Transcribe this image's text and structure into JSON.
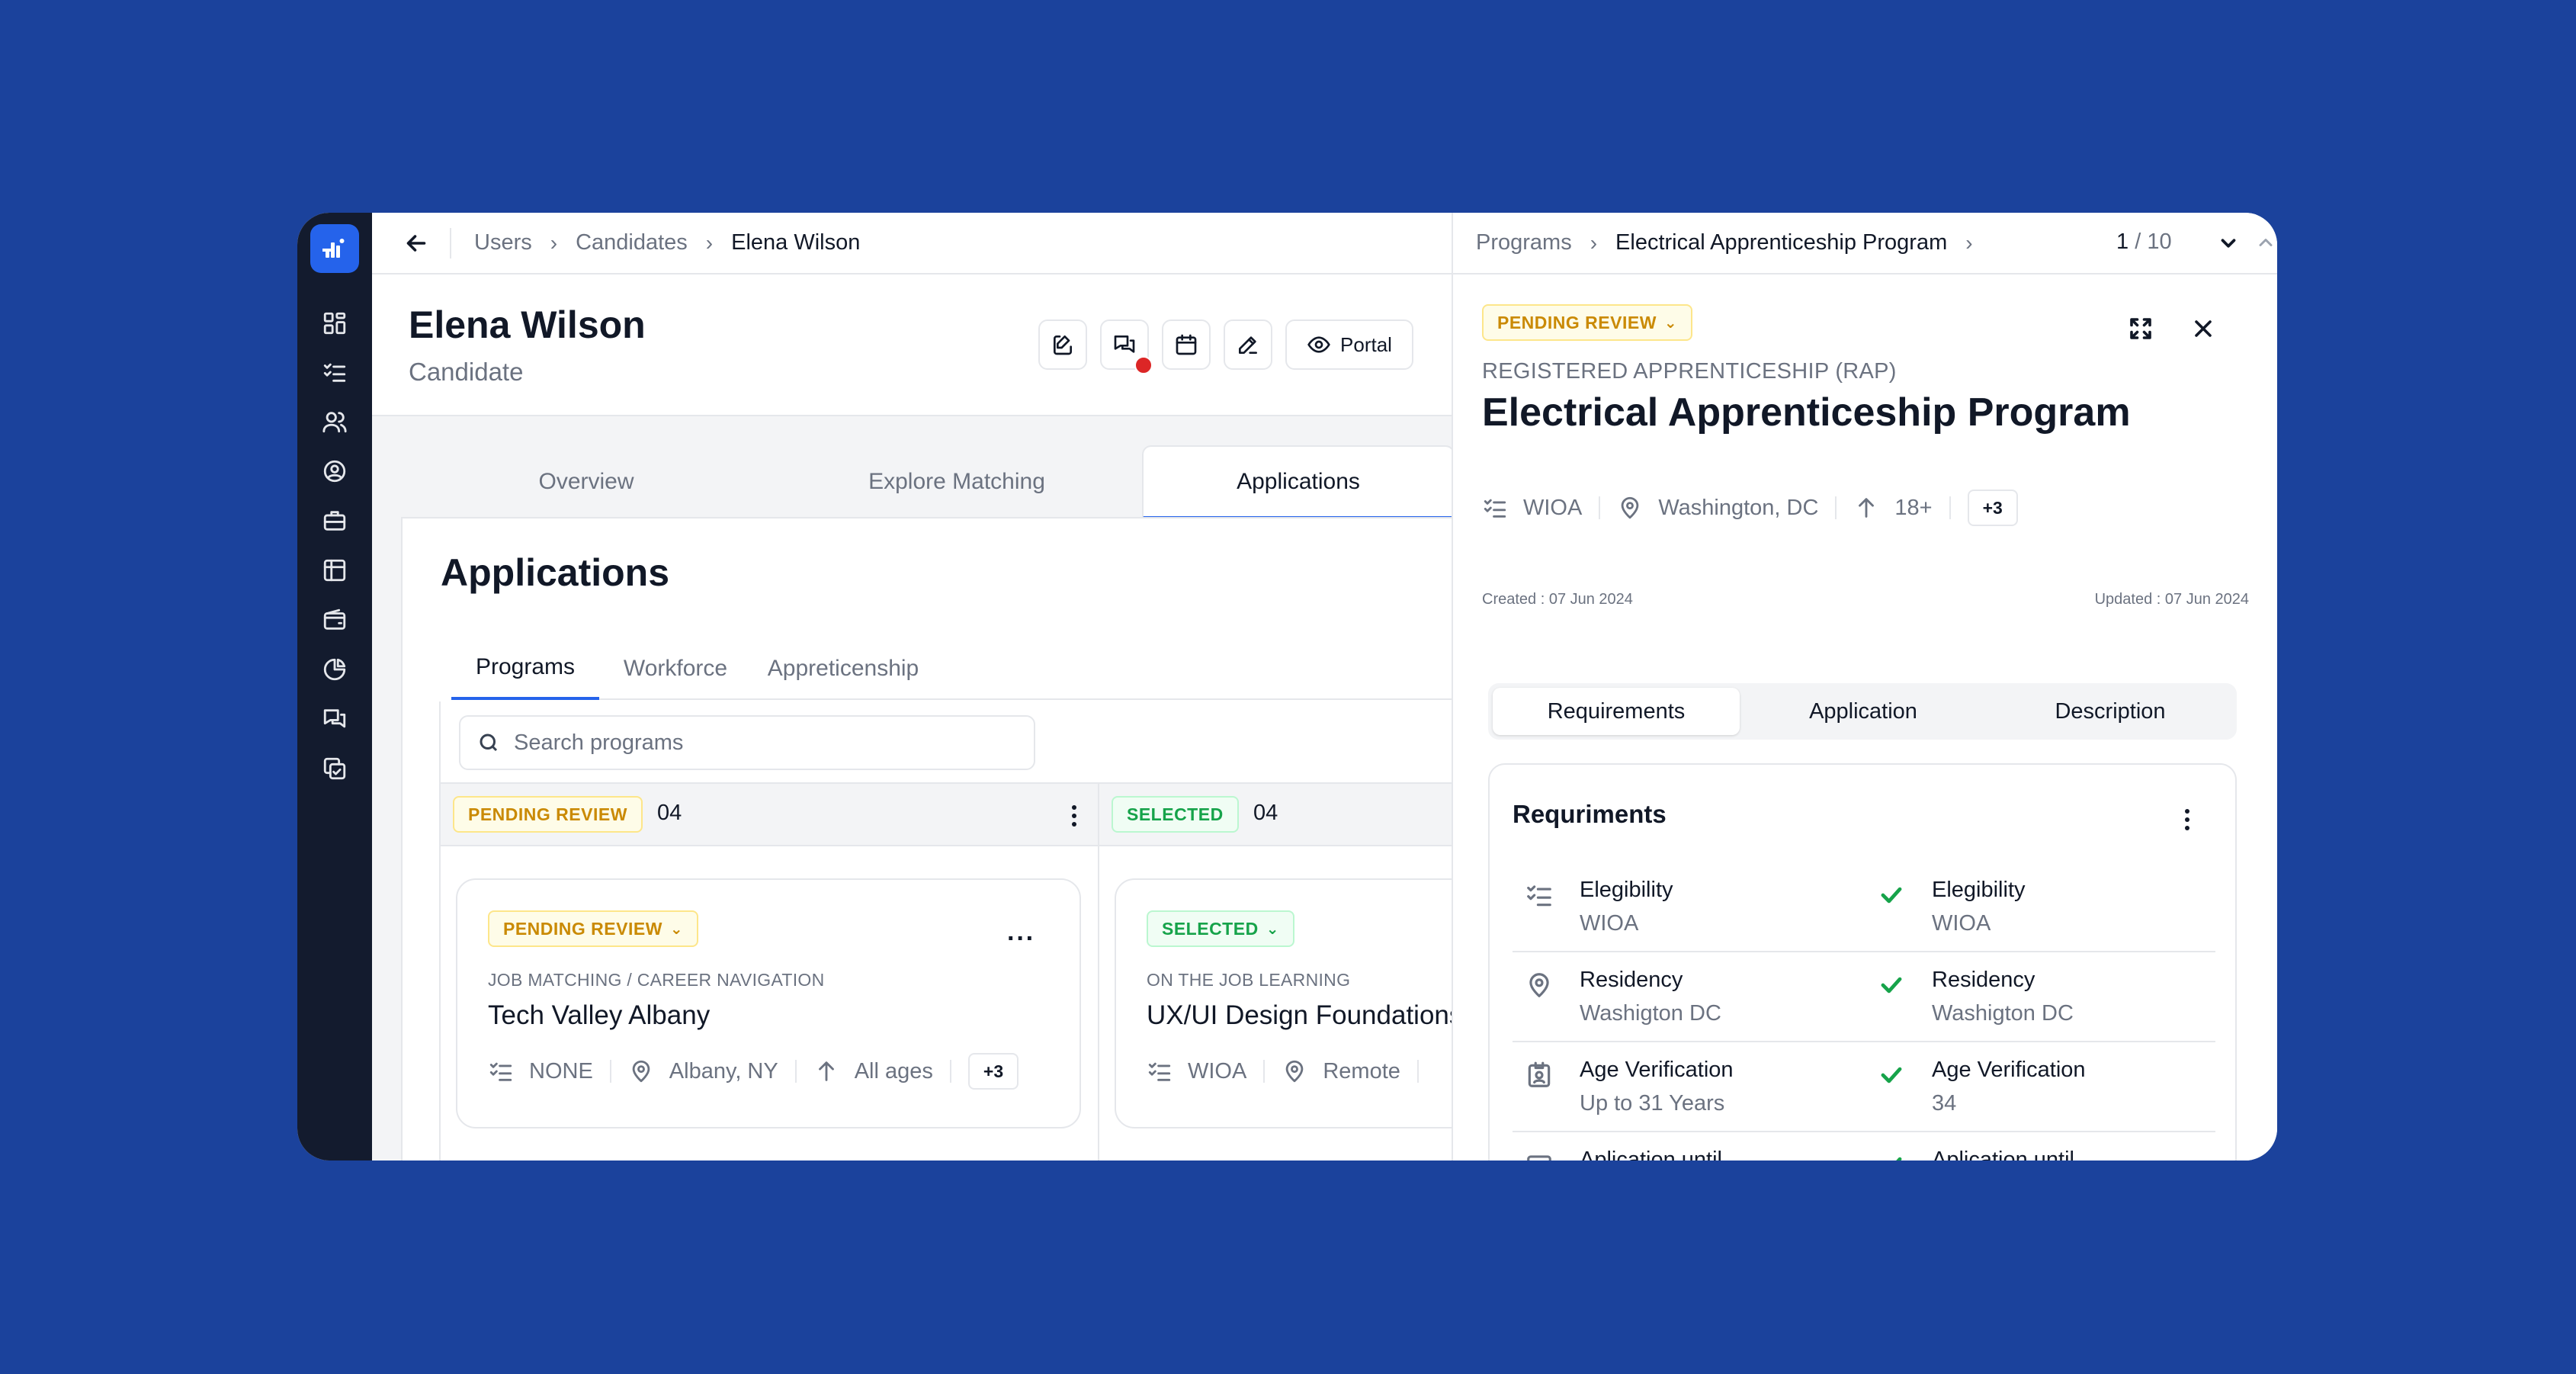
{
  "breadcrumb": {
    "items": [
      "Users",
      "Candidates",
      "Elena Wilson"
    ]
  },
  "candidate": {
    "name": "Elena Wilson",
    "role": "Candidate"
  },
  "header_actions": {
    "portal_label": "Portal",
    "icons": [
      "clipboard-edit-icon",
      "chat-icon",
      "calendar-icon",
      "pencil-icon",
      "eye-icon"
    ]
  },
  "main_tabs": [
    "Overview",
    "Explore Matching",
    "Applications"
  ],
  "applications": {
    "title": "Applications",
    "subtabs": [
      "Programs",
      "Workforce",
      "Appreticenship"
    ],
    "search_placeholder": "Search programs",
    "columns": [
      {
        "status": "PENDING REVIEW",
        "count": "04"
      },
      {
        "status": "SELECTED",
        "count": "04"
      }
    ],
    "cards": [
      {
        "status": "PENDING REVIEW",
        "type": "JOB MATCHING / CAREER NAVIGATION",
        "name": "Tech Valley Albany",
        "eligibility": "NONE",
        "location": "Albany, NY",
        "age": "All ages",
        "more": "+3"
      },
      {
        "status": "SELECTED",
        "type": "ON THE JOB LEARNING",
        "name": "UX/UI Design Foundations",
        "eligibility": "WIOA",
        "location": "Remote"
      }
    ]
  },
  "detail": {
    "breadcrumb": [
      "Programs",
      "Electrical Apprenticeship Program"
    ],
    "pager": {
      "current": "1",
      "total": "/ 10"
    },
    "status": "PENDING REVIEW",
    "category": "REGISTERED APPRENTICESHIP (RAP)",
    "title": "Electrical Apprenticeship Program",
    "meta": {
      "eligibility": "WIOA",
      "location": "Washington, DC",
      "age": "18+",
      "more": "+3"
    },
    "created": "Created : 07 Jun 2024",
    "updated": "Updated : 07 Jun 2024",
    "segments": [
      "Requirements",
      "Application",
      "Description"
    ],
    "requirements_title": "Requirements_placeholder",
    "requirements": [
      {
        "label": "Elegibility",
        "value": "WIOA",
        "match_label": "Elegibility",
        "match_value": "WIOA"
      },
      {
        "label": "Residency",
        "value": "Washigton DC",
        "match_label": "Residency",
        "match_value": "Washigton DC"
      },
      {
        "label": "Age Verification",
        "value": "Up to 31 Years",
        "match_label": "Age Verification",
        "match_value": "34"
      },
      {
        "label": "Aplication until",
        "value": "",
        "match_label": "Aplication until",
        "match_value": ""
      }
    ]
  },
  "colors": {
    "background": "#1b429c",
    "rail": "#131b2e",
    "accent": "#2563eb",
    "pending": "#ca8a04",
    "selected": "#16a34a",
    "notification": "#dc2626"
  }
}
